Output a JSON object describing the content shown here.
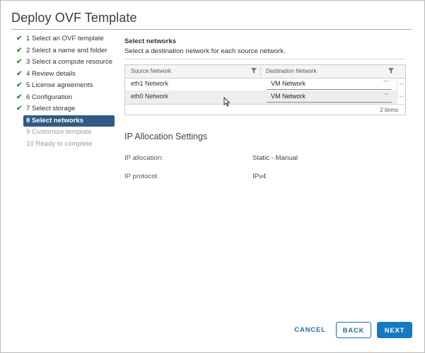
{
  "dialog": {
    "title": "Deploy OVF Template"
  },
  "steps": [
    {
      "label": "1 Select an OVF template",
      "status": "done"
    },
    {
      "label": "2 Select a name and folder",
      "status": "done"
    },
    {
      "label": "3 Select a compute resource",
      "status": "done"
    },
    {
      "label": "4 Review details",
      "status": "done"
    },
    {
      "label": "5 License agreements",
      "status": "done"
    },
    {
      "label": "6 Configuration",
      "status": "done"
    },
    {
      "label": "7 Select storage",
      "status": "done"
    },
    {
      "label": "8 Select networks",
      "status": "active"
    },
    {
      "label": "9 Customize template",
      "status": "disabled"
    },
    {
      "label": "10 Ready to complete",
      "status": "disabled"
    }
  ],
  "networks": {
    "heading": "Select networks",
    "subheading": "Select a destination network for each source network.",
    "columns": {
      "source": "Source Network",
      "destination": "Destination Network"
    },
    "rows": [
      {
        "source": "eth1 Network",
        "destination": "VM Network"
      },
      {
        "source": "eth0 Network",
        "destination": "VM Network"
      }
    ],
    "item_count": "2 items"
  },
  "ip_settings": {
    "title": "IP Allocation Settings",
    "allocation_label": "IP allocation:",
    "allocation_value": "Static - Manual",
    "protocol_label": "IP protocol:",
    "protocol_value": "IPv4"
  },
  "footer": {
    "cancel": "CANCEL",
    "back": "BACK",
    "next": "NEXT"
  },
  "colors": {
    "accent": "#1479c4",
    "active_step": "#2f5b84",
    "check": "#2e8b3a"
  }
}
